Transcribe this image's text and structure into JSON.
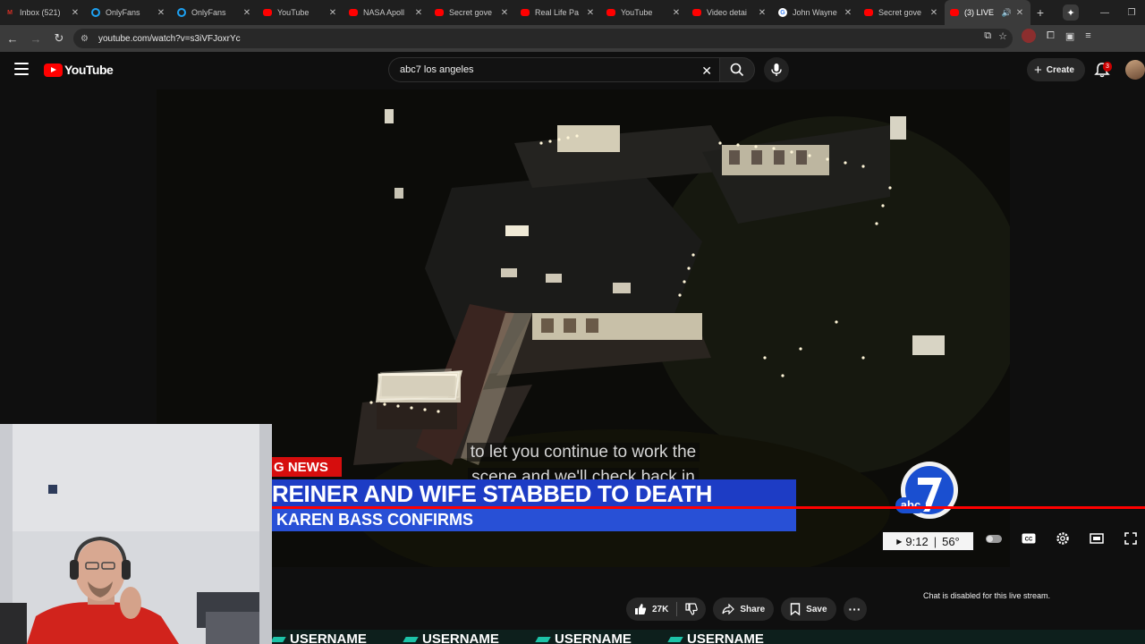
{
  "browser": {
    "tabs": [
      {
        "label": "Inbox (521)",
        "icon": "gmail-icon",
        "color": "#d93025"
      },
      {
        "label": "OnlyFans",
        "icon": "onlyfans-icon",
        "color": "#1da1f2"
      },
      {
        "label": "OnlyFans",
        "icon": "onlyfans-icon",
        "color": "#1da1f2"
      },
      {
        "label": "YouTube",
        "icon": "youtube-icon",
        "color": "#ff0000"
      },
      {
        "label": "NASA Apoll",
        "icon": "youtube-icon",
        "color": "#ff0000"
      },
      {
        "label": "Secret gove",
        "icon": "youtube-icon",
        "color": "#ff0000"
      },
      {
        "label": "Real Life Pa",
        "icon": "youtube-icon",
        "color": "#ff0000"
      },
      {
        "label": "YouTube",
        "icon": "youtube-icon",
        "color": "#ff0000"
      },
      {
        "label": "Video detai",
        "icon": "youtube-studio-icon",
        "color": "#ff0000"
      },
      {
        "label": "John Wayne",
        "icon": "google-icon",
        "color": "#ffffff"
      },
      {
        "label": "Secret gove",
        "icon": "youtube-icon",
        "color": "#ff0000"
      },
      {
        "label": "(3) LIVE",
        "icon": "youtube-icon",
        "color": "#ff0000",
        "active": true
      }
    ],
    "url": "youtube.com/watch?v=s3iVFJoxrYc"
  },
  "header": {
    "logo_text": "YouTube",
    "search_value": "abc7 los angeles",
    "create_label": "Create",
    "notification_count": "3"
  },
  "video": {
    "caption_line1": "to let you continue to work the",
    "caption_line2": "scene and we'll check back in",
    "breaking_tag": "G NEWS",
    "headline": "REINER AND WIFE STABBED TO DEATH",
    "subheadline": "KAREN BASS CONFIRMS",
    "abc_text": "abc"
  },
  "player": {
    "time": "9:12",
    "temperature": "56°"
  },
  "actions": {
    "like_count": "27K",
    "share_label": "Share",
    "save_label": "Save"
  },
  "chat": {
    "disabled_text": "Chat is disabled for this live stream."
  },
  "overlay": {
    "username_label": "USERNAME"
  },
  "colors": {
    "youtube_red": "#ff0000",
    "news_blue": "#1d3cc5",
    "breaking_red": "#d60d0d",
    "background": "#0f0f0f"
  }
}
